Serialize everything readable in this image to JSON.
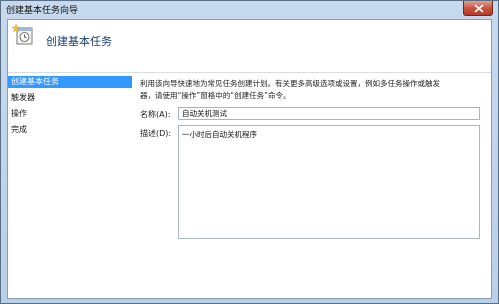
{
  "window": {
    "title": "创建基本任务向导"
  },
  "header": {
    "title": "创建基本任务"
  },
  "sidebar": {
    "steps": [
      {
        "label": "创建基本任务"
      },
      {
        "label": "触发器"
      },
      {
        "label": "操作"
      },
      {
        "label": "完成"
      }
    ]
  },
  "main": {
    "intro_line1": "利用该向导快速地为常见任务创建计划。有关更多高级选项或设置，例如多任务操作或触发",
    "intro_line2": "器，请使用“操作”窗格中的“创建任务”命令。",
    "name_label": "名称(A):",
    "name_value": "自动关机测试",
    "desc_label": "描述(D):",
    "desc_value": "一小时后自动关机程序"
  },
  "colors": {
    "selected_step": "#3399ff",
    "title_bar": "#c7d9ee",
    "close_button": "#c8503c"
  }
}
